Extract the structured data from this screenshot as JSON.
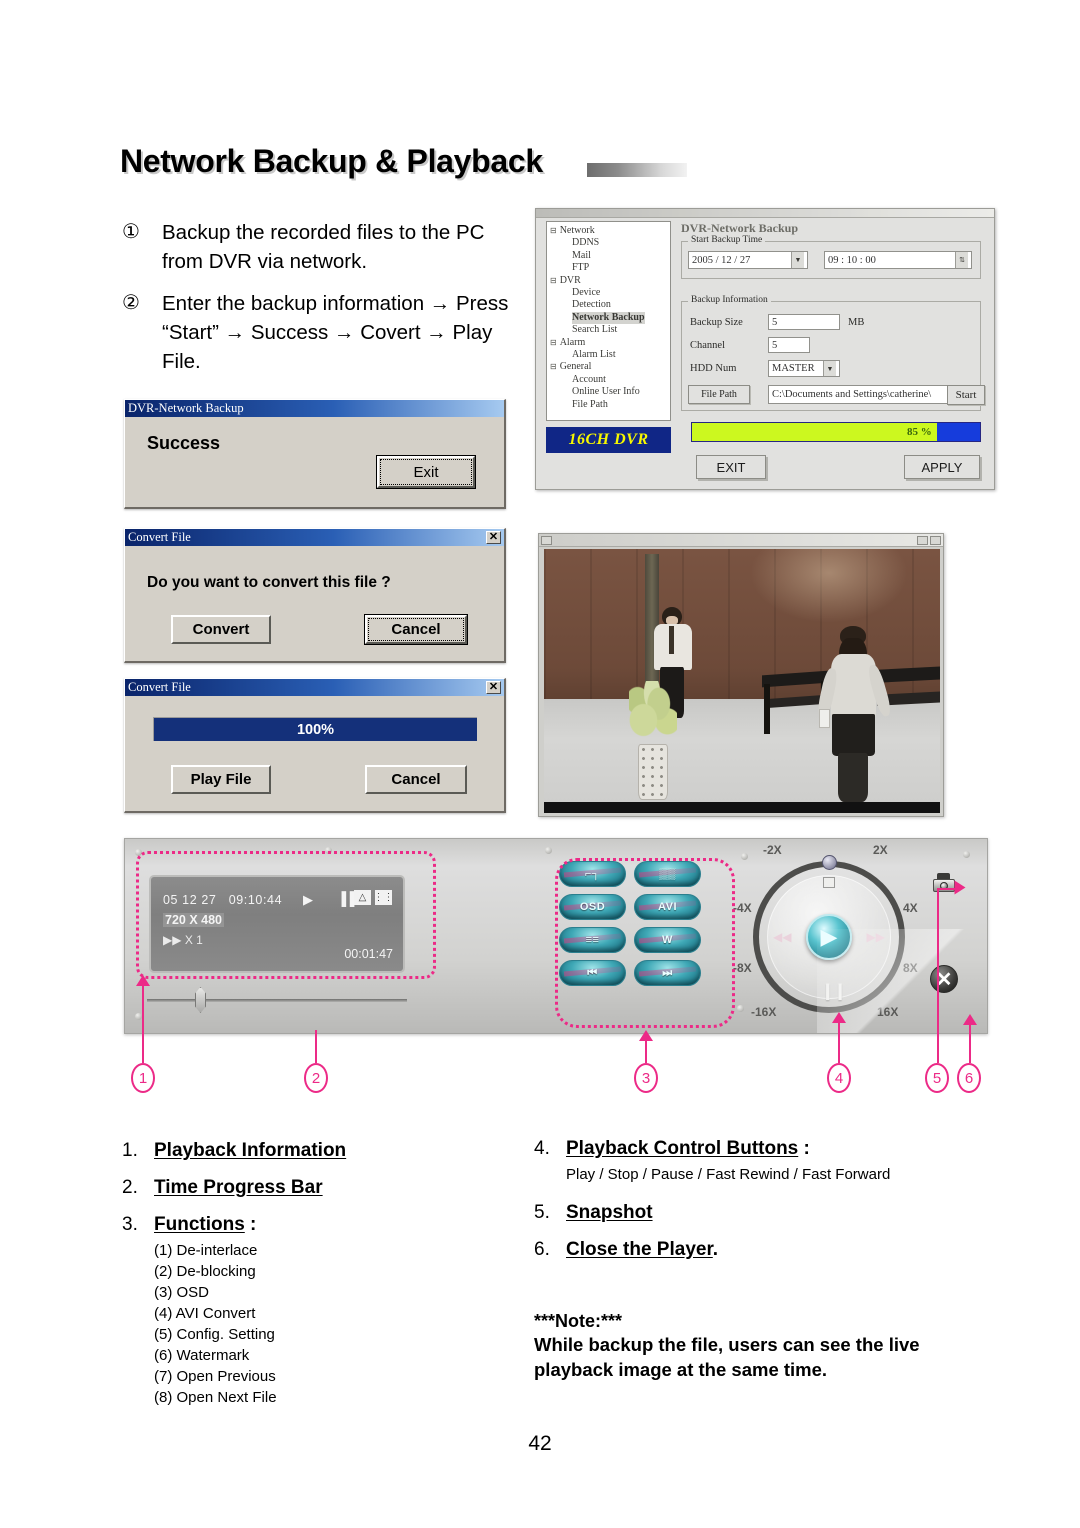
{
  "page": {
    "title": "Network Backup & Playback",
    "number": "42"
  },
  "intro": {
    "steps": [
      {
        "marker": "①",
        "text": "Backup the recorded files to the PC from DVR via network."
      },
      {
        "marker": "②",
        "text": "Enter the backup information → Press “Start” → Success → Covert → Play File."
      }
    ]
  },
  "success_dialog": {
    "title": "DVR-Network Backup",
    "message": "Success",
    "exit_label": "Exit"
  },
  "convert_dialog": {
    "title": "Convert File",
    "close_glyph": "✕",
    "question": "Do you want to convert this file ?",
    "convert_label": "Convert",
    "cancel_label": "Cancel"
  },
  "progress_dialog": {
    "title": "Convert File",
    "close_glyph": "✕",
    "percent_label": "100%",
    "play_label": "Play File",
    "cancel_label": "Cancel"
  },
  "backup_window": {
    "header": "DVR-Network Backup",
    "logo": "16CH DVR",
    "tree": [
      {
        "label": "Network",
        "level": 0,
        "selected": false
      },
      {
        "label": "DDNS",
        "level": 1,
        "selected": false
      },
      {
        "label": "Mail",
        "level": 1,
        "selected": false
      },
      {
        "label": "FTP",
        "level": 1,
        "selected": false
      },
      {
        "label": "DVR",
        "level": 0,
        "selected": false
      },
      {
        "label": "Device",
        "level": 1,
        "selected": false
      },
      {
        "label": "Detection",
        "level": 1,
        "selected": false
      },
      {
        "label": "Network Backup",
        "level": 1,
        "selected": true
      },
      {
        "label": "Search List",
        "level": 1,
        "selected": false
      },
      {
        "label": "Alarm",
        "level": 0,
        "selected": false
      },
      {
        "label": "Alarm List",
        "level": 1,
        "selected": false
      },
      {
        "label": "General",
        "level": 0,
        "selected": false
      },
      {
        "label": "Account",
        "level": 1,
        "selected": false
      },
      {
        "label": "Online User Info",
        "level": 1,
        "selected": false
      },
      {
        "label": "File Path",
        "level": 1,
        "selected": false
      }
    ],
    "start_backup_time": {
      "legend": "Start Backup Time",
      "date": "2005 / 12 / 27",
      "time": "09 : 10 : 00"
    },
    "backup_information": {
      "legend": "Backup Information",
      "backup_size_label": "Backup Size",
      "backup_size_value": "5",
      "backup_size_unit": "MB",
      "channel_label": "Channel",
      "channel_value": "5",
      "hdd_num_label": "HDD Num",
      "hdd_num_value": "MASTER",
      "file_path_label": "File Path",
      "file_path_value": "C:\\Documents and Settings\\catherine\\",
      "start_label": "Start"
    },
    "progress_percent": "85 %",
    "progress_value": 85,
    "exit_label": "EXIT",
    "apply_label": "APPLY"
  },
  "player": {
    "lcd": {
      "date": "05  12  27",
      "time": "09:10:44",
      "resolution": "720 X 480",
      "speed": "X 1",
      "elapsed": "00:01:47",
      "play_glyph": "▶",
      "pause_glyph": "▐▐",
      "speed_prefix": "▶▶"
    },
    "function_buttons": [
      {
        "name": "de-interlace",
        "label": "⌐┐"
      },
      {
        "name": "de-blocking",
        "label": "▒▒"
      },
      {
        "name": "osd",
        "label": "OSD"
      },
      {
        "name": "avi-convert",
        "label": "AVI"
      },
      {
        "name": "config-setting",
        "label": "≡≡"
      },
      {
        "name": "watermark",
        "label": "W"
      },
      {
        "name": "open-previous",
        "label": "⏮"
      },
      {
        "name": "open-next",
        "label": "⏭"
      }
    ],
    "jog_labels": [
      "-2X",
      "2X",
      "-4X",
      "4X",
      "-8X",
      "8X",
      "-16X",
      "16X"
    ],
    "hub_glyph": "▶",
    "close_glyph": "✕",
    "callouts": [
      "1",
      "2",
      "3",
      "4",
      "5",
      "6"
    ]
  },
  "legend_left": [
    {
      "num": "1.",
      "title": "Playback Information"
    },
    {
      "num": "2.",
      "title": "Time Progress Bar"
    },
    {
      "num": "3.",
      "title": "Functions",
      "suffix": " :"
    }
  ],
  "functions_sublist": [
    "(1) De-interlace",
    "(2) De-blocking",
    "(3) OSD",
    "(4) AVI Convert",
    "(5) Config. Setting",
    "(6) Watermark",
    "(7) Open Previous",
    "(8) Open Next File"
  ],
  "legend_right": {
    "item4_num": "4.",
    "item4_title": "Playback Control Buttons",
    "item4_suffix": " :",
    "item4_detail": "Play / Stop / Pause / Fast Rewind / Fast Forward",
    "item5_num": "5.",
    "item5_title": "Snapshot",
    "item6_num": "6.",
    "item6_title": "Close the Player",
    "item6_suffix": ".",
    "note_header": "***Note:***",
    "note_body": "While backup the file, users can see the live playback image at the same time."
  },
  "colors": {
    "accent_pink": "#ec2a87",
    "title_blue": "#0a246a",
    "progress_green": "#c8f224",
    "progress_blue": "#1b3fd8",
    "logo_yellow": "#f2f200"
  }
}
